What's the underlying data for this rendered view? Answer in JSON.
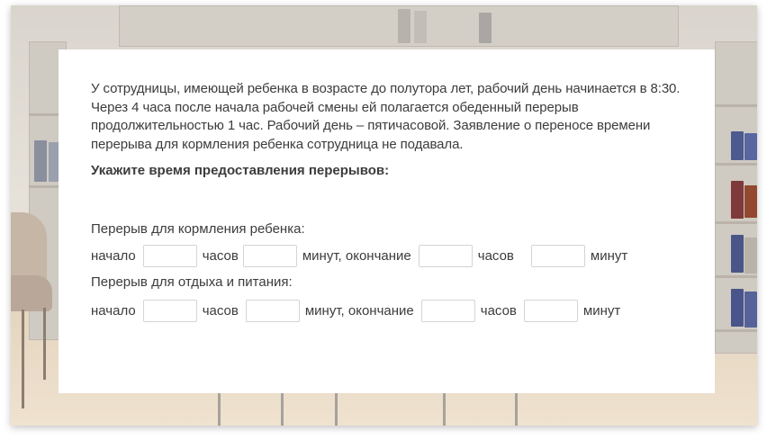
{
  "task": {
    "paragraph": "У сотрудницы, имеющей ребенка в возрасте до полутора лет, рабочий день начинается в 8:30. Через 4 часа после начала рабочей смены ей полагается обеденный перерыв продолжительностью 1 час. Рабочий день – пятичасовой. Заявление о переносе времени перерыва для кормления ребенка сотрудница не подавала.",
    "instruction": "Укажите время предоставления перерывов:"
  },
  "breaks": [
    {
      "title": "Перерыв для кормления ребенка:",
      "start_label": "начало",
      "hours_label": "часов",
      "minutes_end_label": "минут, окончание",
      "hours_label_2": "часов",
      "minutes_label": "минут",
      "values": {
        "start_hours": "",
        "start_minutes": "",
        "end_hours": "",
        "end_minutes": ""
      }
    },
    {
      "title": "Перерыв для отдыха и питания:",
      "start_label": "начало",
      "hours_label": "часов",
      "minutes_end_label": "минут, окончание",
      "hours_label_2": "часов",
      "minutes_label": "минут",
      "values": {
        "start_hours": "",
        "start_minutes": "",
        "end_hours": "",
        "end_minutes": ""
      }
    }
  ],
  "colors": {
    "text": "#3c3c3c",
    "input_border": "#d4d4d4",
    "card": "#ffffff"
  }
}
